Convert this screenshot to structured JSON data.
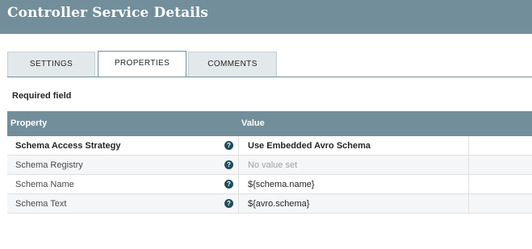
{
  "header": {
    "title": "Controller Service Details"
  },
  "tabs": [
    {
      "label": "SETTINGS"
    },
    {
      "label": "PROPERTIES"
    },
    {
      "label": "COMMENTS"
    }
  ],
  "required_label": "Required field",
  "table": {
    "columns": [
      "Property",
      "Value"
    ],
    "rows": [
      {
        "property": "Schema Access Strategy",
        "value": "Use Embedded Avro Schema"
      },
      {
        "property": "Schema Registry",
        "value": "No value set"
      },
      {
        "property": "Schema Name",
        "value": "${schema.name}"
      },
      {
        "property": "Schema Text",
        "value": "${avro.schema}"
      }
    ],
    "help_glyph": "?"
  },
  "colors": {
    "header": "#728e9b",
    "help_icon": "#1f4e5c"
  }
}
